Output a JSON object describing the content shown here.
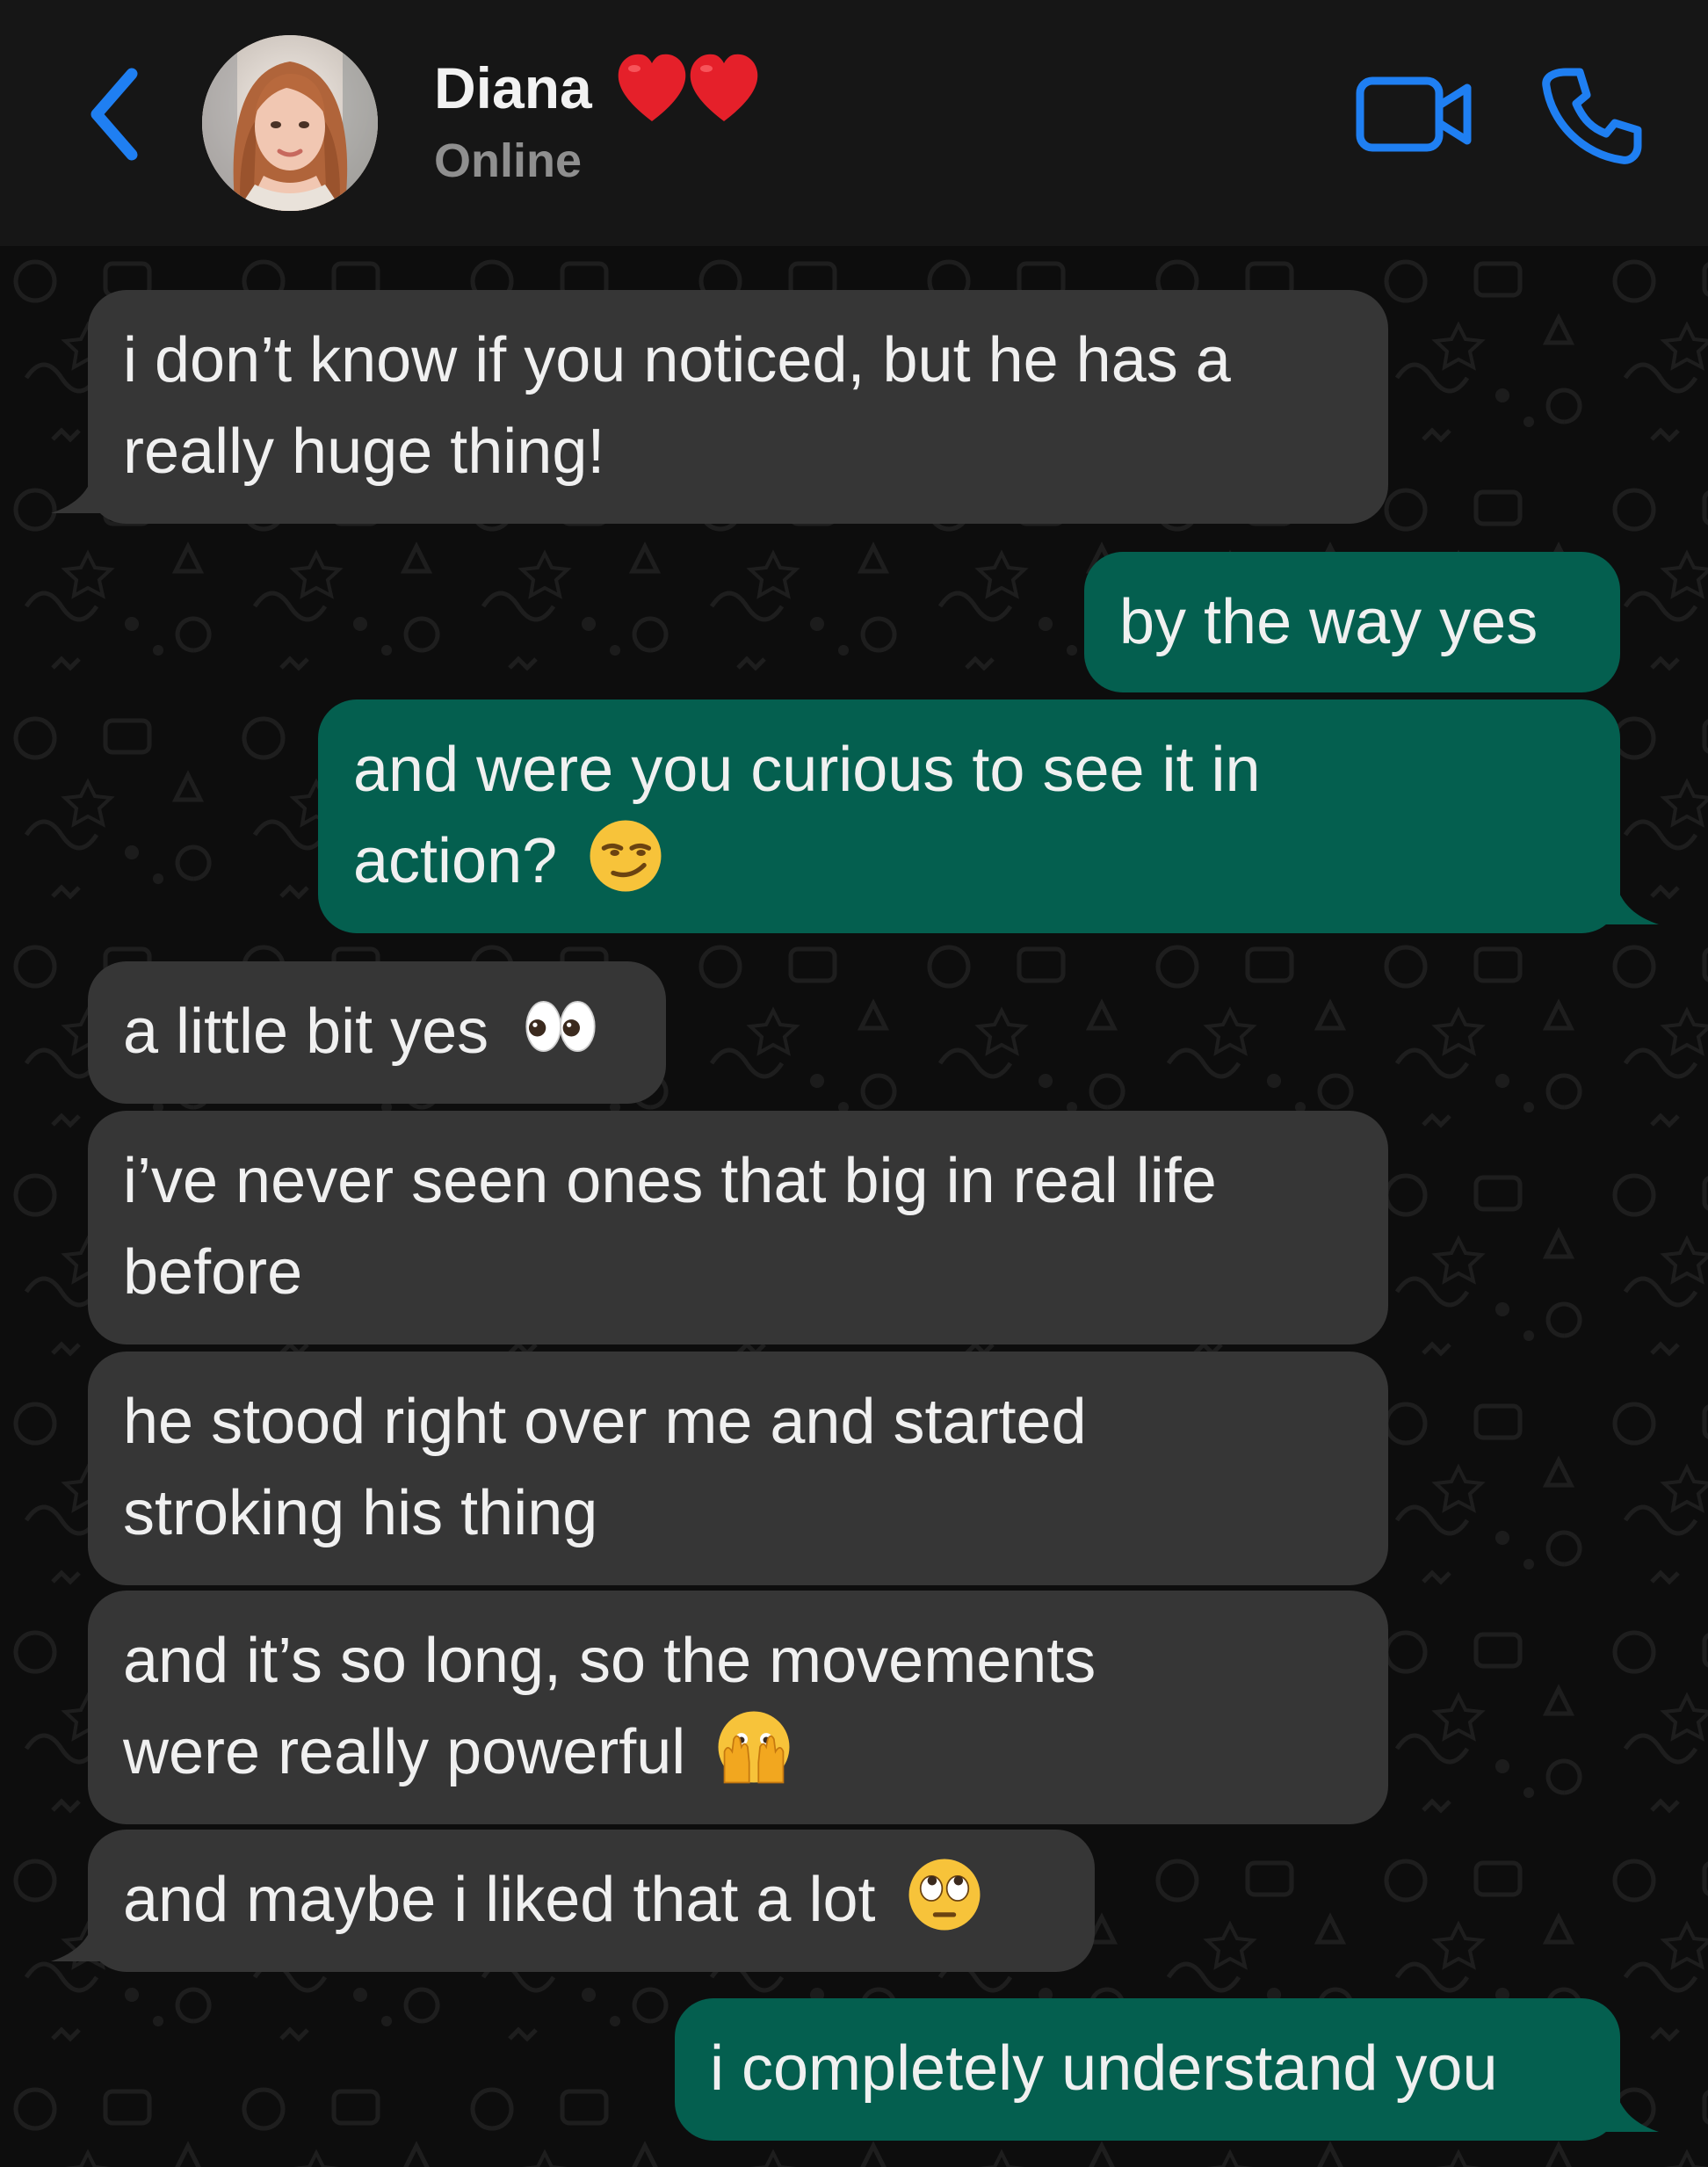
{
  "header": {
    "contact_name": "Diana",
    "name_decoration": "two-red-hearts",
    "status": "Online",
    "icons": [
      "back-chevron-icon",
      "video-call-icon",
      "phone-call-icon"
    ],
    "accent_color": "#1f7ff2"
  },
  "chat": {
    "incoming_color": "#363636",
    "outgoing_color": "#045f4f",
    "messages": [
      {
        "direction": "incoming",
        "lines": [
          "i don’t know if you noticed, but he has a",
          "really huge thing!"
        ],
        "emoji": ""
      },
      {
        "direction": "outgoing",
        "lines": [
          "by the way yes"
        ],
        "emoji": ""
      },
      {
        "direction": "outgoing",
        "lines": [
          "and were you curious to see it in",
          "action?"
        ],
        "emoji": "smirking-face"
      },
      {
        "direction": "incoming",
        "lines": [
          "a little bit yes"
        ],
        "emoji": "eyes"
      },
      {
        "direction": "incoming",
        "lines": [
          "i’ve never seen ones that big in real life",
          "before"
        ],
        "emoji": ""
      },
      {
        "direction": "incoming",
        "lines": [
          "he stood right over me and started",
          "stroking his thing"
        ],
        "emoji": ""
      },
      {
        "direction": "incoming",
        "lines": [
          "and it’s so long, so the movements",
          "were really powerful"
        ],
        "emoji": "face-with-open-eyes-and-hand-over-mouth"
      },
      {
        "direction": "incoming",
        "lines": [
          "and maybe i liked that a lot"
        ],
        "emoji": "face-with-rolling-eyes"
      },
      {
        "direction": "outgoing",
        "lines": [
          "i completely understand you"
        ],
        "emoji": ""
      }
    ]
  }
}
